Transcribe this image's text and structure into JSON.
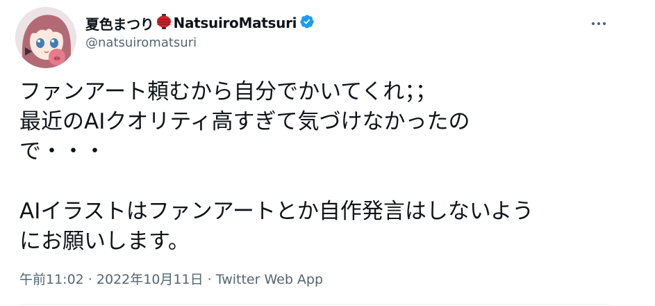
{
  "author": {
    "display_name": "夏色まつり",
    "display_name_en": "NatsuiroMatsuri",
    "handle": "@natsuiromatsuri"
  },
  "tweet": {
    "lines": [
      "ファンアート頼むから自分でかいてくれ；；",
      "最近のAIクオリティ高すぎて気づけなかったの",
      "で・・・",
      "",
      "AIイラストはファンアートとか自作発言はしないよう",
      "にお願いします。"
    ]
  },
  "meta": {
    "time": "午前11:02",
    "separator1": " · ",
    "date": "2022年10月11日",
    "separator2": " · ",
    "source": "Twitter Web App"
  },
  "colors": {
    "text": "#0f1419",
    "secondary": "#536471",
    "verified": "#1d9bf0",
    "lantern": "#d4202b"
  },
  "icons": {
    "more": "more-horizontal-icon",
    "verified": "verified-badge-icon",
    "lantern": "red-lantern-emoji-icon"
  }
}
